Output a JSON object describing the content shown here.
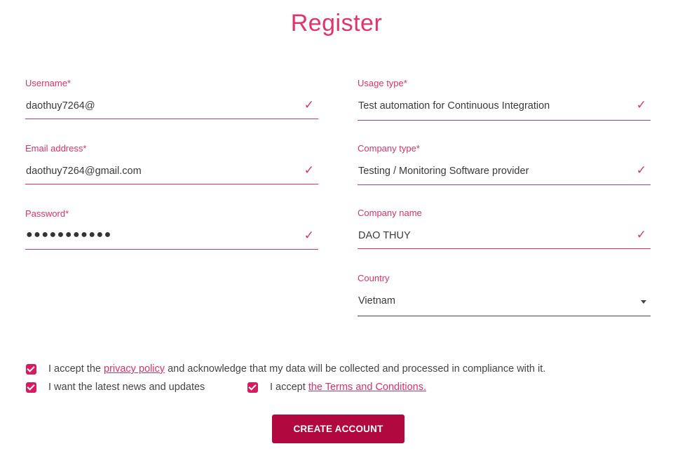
{
  "page": {
    "title": "Register"
  },
  "left_fields": [
    {
      "label": "Username*",
      "value": "daothuy7264@",
      "valid": true
    },
    {
      "label": "Email address*",
      "value": "daothuy7264@gmail.com",
      "valid": true
    },
    {
      "label": "Password*",
      "value": "●●●●●●●●●●●",
      "valid": true
    }
  ],
  "right_fields": [
    {
      "label": "Usage type*",
      "value": "Test automation for Continuous Integration",
      "valid": true
    },
    {
      "label": "Company type*",
      "value": "Testing / Monitoring Software provider",
      "valid": true
    },
    {
      "label": "Company name",
      "value": "DAO THUY",
      "valid": true
    },
    {
      "label": "Country",
      "value": "Vietnam"
    }
  ],
  "icons": {
    "valid": "✓"
  },
  "consents": {
    "privacy": {
      "checked": true,
      "prefix": "I accept the",
      "link": "privacy policy",
      "suffix": "and acknowledge that my data will be collected and processed in compliance with it."
    },
    "news": {
      "checked": true,
      "text": "I want the latest news and updates"
    },
    "terms": {
      "checked": true,
      "prefix": "I accept",
      "link": "the Terms and Conditions."
    }
  },
  "submit": {
    "label": "CREATE ACCOUNT"
  },
  "colors": {
    "accent": "#d6336c",
    "button": "#b0083f",
    "checkbox": "#d81b60"
  }
}
